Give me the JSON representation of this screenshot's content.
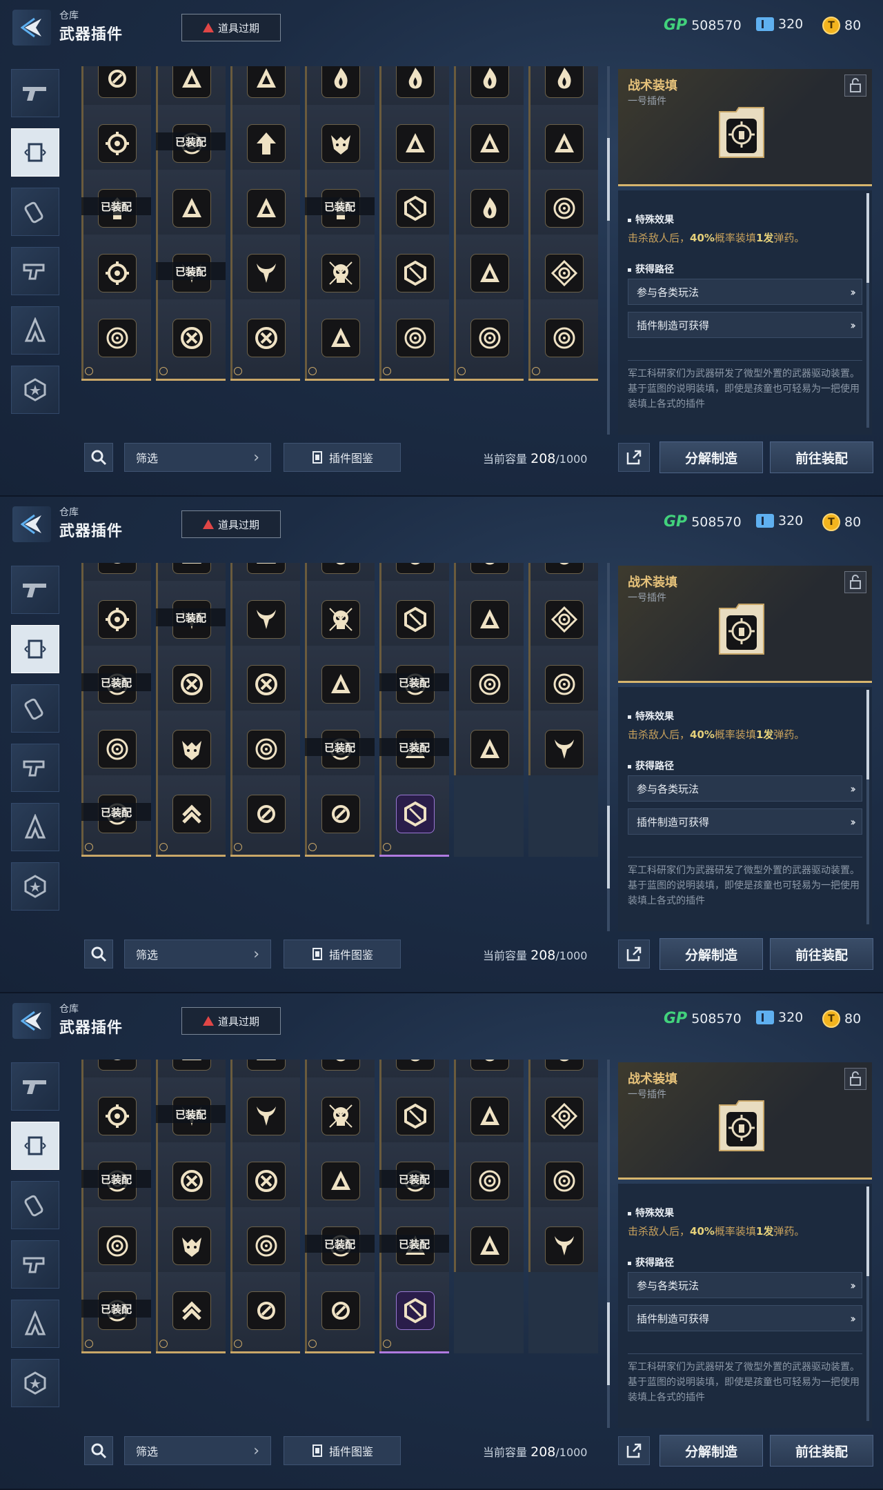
{
  "header": {
    "breadcrumb": "仓库",
    "title": "武器插件",
    "expire_label": "道具过期",
    "gp_label": "GP",
    "gp_value": "508570",
    "ticket_value": "320",
    "coin_value": "80"
  },
  "detail": {
    "name": "战术装填",
    "subtitle": "一号插件",
    "effect_heading": "特殊效果",
    "effect_a": "击杀敌人后，",
    "effect_pct": "40%",
    "effect_b": "概率装填",
    "effect_num": "1发",
    "effect_c": "弹药。",
    "route_heading": "获得路径",
    "route1": "参与各类玩法",
    "route2": "插件制造可获得",
    "desc1": "军工科研家们为武器研发了微型外置的武器驱动装置。",
    "desc2": "基于蓝图的说明装填，即使是孩童也可轻易为一把使用装填上各式的插件"
  },
  "bottom": {
    "filter_label": "筛选",
    "codex_label": "插件图鉴",
    "capacity_label": "当前容量",
    "capacity_value": "208",
    "capacity_max": "/1000",
    "decompose_label": "分解制造",
    "goto_equip_label": "前往装配"
  },
  "equipped_label": "已装配",
  "panels": [
    {
      "rows": [
        [
          "ring",
          "tri",
          "tri",
          "flame",
          "flame",
          "flame",
          "flame"
        ],
        [
          "gear",
          "target",
          "arrowup",
          "wolf",
          "tri",
          "tri",
          "tri"
        ],
        [
          "arrowup",
          "tri",
          "tri",
          "arrowup",
          "hexagon",
          "flame",
          "target"
        ],
        [
          "gear",
          "horns",
          "horns",
          "skull",
          "hexagon",
          "tri",
          "diamond"
        ],
        [
          "target",
          "circlex",
          "circlex",
          "tri",
          "target",
          "target",
          "target"
        ]
      ],
      "equipped": [
        [
          1,
          1
        ],
        [
          2,
          0
        ],
        [
          2,
          3
        ],
        [
          3,
          1
        ]
      ],
      "empty": [],
      "purple": []
    },
    {
      "rows": [
        [
          "gear",
          "horns",
          "horns",
          "skull",
          "hexagon",
          "tri",
          "diamond"
        ],
        [
          "target",
          "circlex",
          "circlex",
          "tri",
          "target",
          "target",
          "target"
        ],
        [
          "target",
          "wolf",
          "target",
          "target",
          "tri",
          "tri",
          "horns"
        ],
        [
          "target",
          "chevrons",
          "ring",
          "ring",
          "hexagon",
          "",
          ""
        ]
      ],
      "equipped": [
        [
          0,
          1
        ],
        [
          1,
          0
        ],
        [
          1,
          4
        ],
        [
          2,
          3
        ],
        [
          2,
          4
        ],
        [
          3,
          0
        ]
      ],
      "empty": [
        [
          3,
          5
        ],
        [
          3,
          6
        ]
      ],
      "purple": [
        [
          3,
          4
        ]
      ]
    },
    {
      "rows": [
        [
          "gear",
          "horns",
          "horns",
          "skull",
          "hexagon",
          "tri",
          "diamond"
        ],
        [
          "target",
          "circlex",
          "circlex",
          "tri",
          "target",
          "target",
          "target"
        ],
        [
          "target",
          "wolf",
          "target",
          "target",
          "tri",
          "tri",
          "horns"
        ],
        [
          "target",
          "chevrons",
          "ring",
          "ring",
          "hexagon",
          "",
          ""
        ]
      ],
      "equipped": [
        [
          0,
          1
        ],
        [
          1,
          0
        ],
        [
          1,
          4
        ],
        [
          2,
          3
        ],
        [
          2,
          4
        ],
        [
          3,
          0
        ]
      ],
      "empty": [
        [
          3,
          5
        ],
        [
          3,
          6
        ]
      ],
      "purple": [
        [
          3,
          4
        ]
      ]
    }
  ],
  "scroll_progress": [
    0.25,
    0.85,
    0.85
  ],
  "colors": {
    "accent_gold": "#c9a768",
    "gp_green": "#42d27c",
    "warn_red": "#e04646",
    "rare_purple": "#b07ae0"
  }
}
